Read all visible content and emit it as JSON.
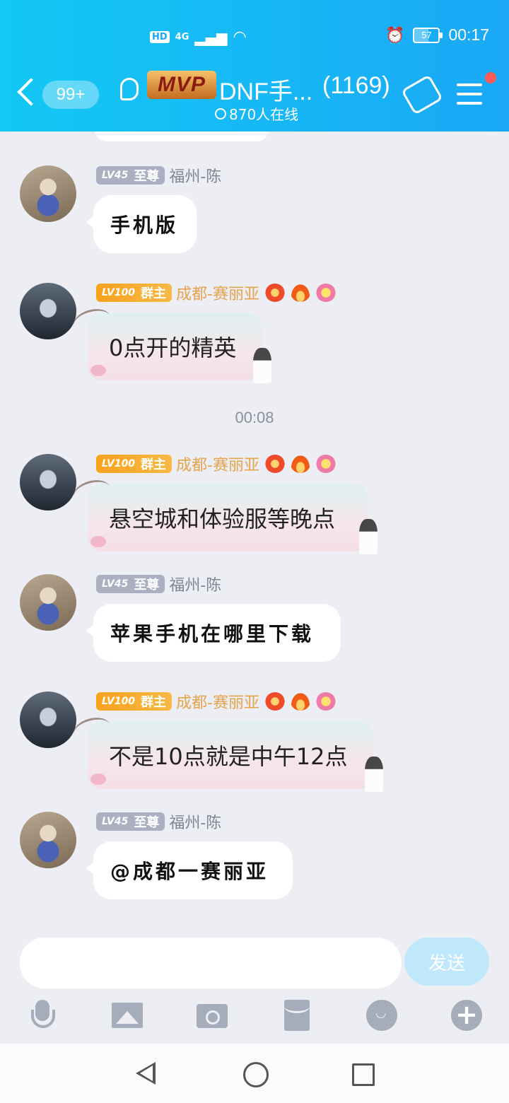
{
  "status_bar": {
    "network": "4G",
    "hd": "HD",
    "battery": "57",
    "battery_level": 0.57,
    "time": "00:17"
  },
  "header": {
    "back_badge": "99+",
    "mvp_label": "MVP",
    "title": "DNF手...",
    "member_count": "(1169)",
    "online": "870人在线"
  },
  "messages": [
    {
      "level": "LV45",
      "rank": "至尊",
      "sender": "福州-陈",
      "text": "手机版"
    },
    {
      "level": "LV100",
      "rank": "群主",
      "sender": "成都-赛丽亚",
      "text": "0点开的精英"
    },
    {
      "level": "LV100",
      "rank": "群主",
      "sender": "成都-赛丽亚",
      "text": "悬空城和体验服等晚点"
    },
    {
      "level": "LV45",
      "rank": "至尊",
      "sender": "福州-陈",
      "text": "苹果手机在哪里下载"
    },
    {
      "level": "LV100",
      "rank": "群主",
      "sender": "成都-赛丽亚",
      "text": "不是10点就是中午12点"
    },
    {
      "level": "LV45",
      "rank": "至尊",
      "sender": "福州-陈",
      "text": "@成都一赛丽亚"
    }
  ],
  "timestamp": "00:08",
  "composer": {
    "placeholder": "",
    "send_label": "发送"
  },
  "icons": [
    "mic-icon",
    "image-icon",
    "camera-icon",
    "red-packet-icon",
    "emoji-icon",
    "plus-icon"
  ],
  "colors": {
    "header": "#1aa8f6",
    "accent_gold": "#f8a21e",
    "send_disabled": "#bfe8fb"
  }
}
